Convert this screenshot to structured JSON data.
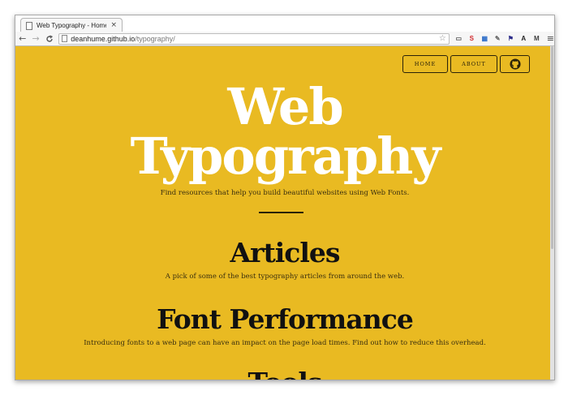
{
  "browser": {
    "tab_title": "Web Typography - Home",
    "tab_close": "×",
    "back": "←",
    "forward": "→",
    "reload": "C",
    "url_host": "deanhume.github.io",
    "url_path": "/typography/",
    "star": "☆",
    "menu": "≡",
    "extensions": [
      {
        "glyph": "▭",
        "color": "#555555"
      },
      {
        "glyph": "S",
        "color": "#d1262a"
      },
      {
        "glyph": "▦",
        "color": "#2f6fc8"
      },
      {
        "glyph": "✎",
        "color": "#666666"
      },
      {
        "glyph": "⚑",
        "color": "#2c2c8a"
      },
      {
        "glyph": "A",
        "color": "#222222"
      },
      {
        "glyph": "M",
        "color": "#3c3c3c"
      }
    ]
  },
  "nav": {
    "home": "HOME",
    "about": "ABOUT"
  },
  "hero": {
    "title_line1": "Web",
    "title_line2": "Typography",
    "tagline": "Find resources that help you build beautiful websites using Web Fonts."
  },
  "sections": [
    {
      "title": "Articles",
      "description": "A pick of some of the best typography articles from around the web."
    },
    {
      "title": "Font Performance",
      "description": "Introducing fonts to a web page can have an impact on the page load times. Find out how to reduce this overhead."
    },
    {
      "title": "Tools",
      "description": ""
    }
  ],
  "colors": {
    "page_background": "#e9ba22",
    "hero_text": "#ffffff",
    "heading_text": "#111111"
  }
}
